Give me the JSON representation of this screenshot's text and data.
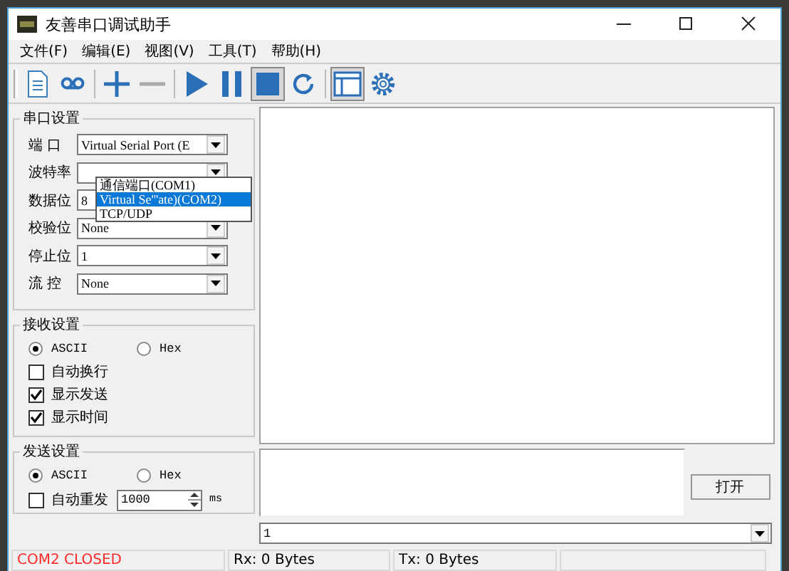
{
  "window": {
    "title": "友善串口调试助手"
  },
  "menu": [
    "文件(F)",
    "编辑(E)",
    "视图(V)",
    "工具(T)",
    "帮助(H)"
  ],
  "toolbar": [
    {
      "kind": "document",
      "pressed": false
    },
    {
      "kind": "tape",
      "pressed": false
    },
    {
      "kind": "separator"
    },
    {
      "kind": "plus",
      "pressed": false
    },
    {
      "kind": "minus",
      "pressed": false
    },
    {
      "kind": "separator"
    },
    {
      "kind": "play",
      "pressed": false
    },
    {
      "kind": "pause",
      "pressed": false
    },
    {
      "kind": "stop",
      "pressed": true
    },
    {
      "kind": "refresh",
      "pressed": false
    },
    {
      "kind": "separator"
    },
    {
      "kind": "window",
      "pressed": true
    },
    {
      "kind": "gear",
      "pressed": false
    }
  ],
  "serial_settings": {
    "title": "串口设置",
    "fields": [
      {
        "label": "端 口",
        "value": "Virtual Serial Port (E"
      },
      {
        "label": "波特率"
      },
      {
        "label": "数据位",
        "value": "8"
      },
      {
        "label": "校验位",
        "value": "None"
      },
      {
        "label": "停止位",
        "value": "1"
      },
      {
        "label": "流 控",
        "value": "None"
      }
    ],
    "port_dropdown": [
      {
        "label": "通信端口(COM1)",
        "selected": false
      },
      {
        "label": "Virtual Se'''ate)(COM2)",
        "selected": true
      },
      {
        "label": "TCP/UDP",
        "selected": false
      }
    ]
  },
  "receive_settings": {
    "title": "接收设置",
    "format": [
      {
        "label": "ASCII",
        "selected": true
      },
      {
        "label": "Hex",
        "selected": false
      }
    ],
    "options": [
      {
        "label": "自动换行",
        "checked": false
      },
      {
        "label": "显示发送",
        "checked": true
      },
      {
        "label": "显示时间",
        "checked": true
      }
    ]
  },
  "send_settings": {
    "title": "发送设置",
    "format": [
      {
        "label": "ASCII",
        "selected": true
      },
      {
        "label": "Hex",
        "selected": false
      }
    ],
    "auto_resend": {
      "label": "自动重发",
      "checked": false,
      "value": "1000",
      "unit": "ms"
    }
  },
  "open_button": "打开",
  "history_combo": {
    "value": "1"
  },
  "status_bar": [
    {
      "text": "COM2 CLOSED",
      "kind": "error"
    },
    {
      "text": "Rx: 0 Bytes",
      "kind": "normal"
    },
    {
      "text": "Tx: 0 Bytes",
      "kind": "normal"
    }
  ]
}
